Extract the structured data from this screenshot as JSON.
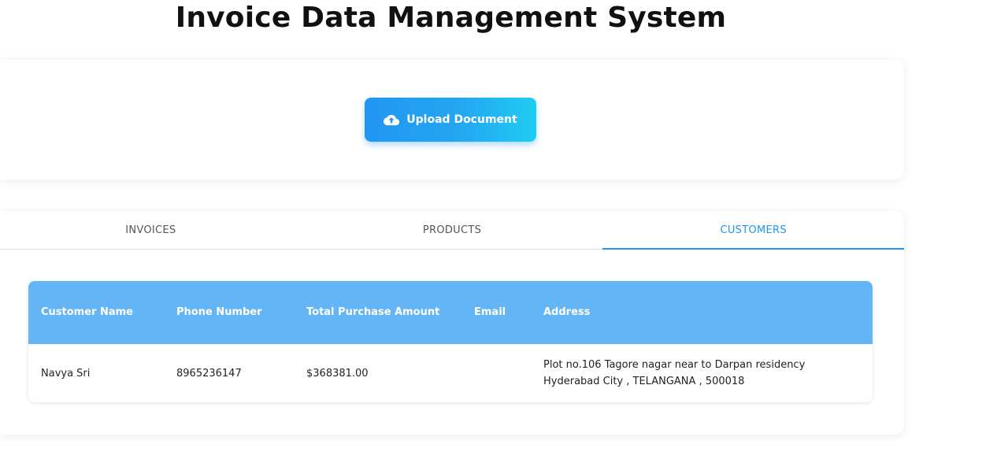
{
  "header": {
    "title": "Invoice Data Management System"
  },
  "upload": {
    "label": "Upload Document",
    "icon": "cloud-upload-icon"
  },
  "tabs": [
    {
      "label": "INVOICES",
      "active": false
    },
    {
      "label": "PRODUCTS",
      "active": false
    },
    {
      "label": "CUSTOMERS",
      "active": true
    }
  ],
  "table": {
    "headers": {
      "customer_name": "Customer Name",
      "phone_number": "Phone Number",
      "total_purchase_amount": "Total Purchase Amount",
      "email": "Email",
      "address": "Address"
    },
    "rows": [
      {
        "customer_name": "Navya Sri",
        "phone_number": "8965236147",
        "total_purchase_amount": "$368381.00",
        "email": "",
        "address": "Plot no.106 Tagore nagar near to Darpan residency Hyderabad City , TELANGANA , 500018"
      }
    ]
  },
  "colors": {
    "accent": "#2196f3",
    "table_header": "#64b5f6",
    "button_gradient_end": "#1fcdf3"
  }
}
